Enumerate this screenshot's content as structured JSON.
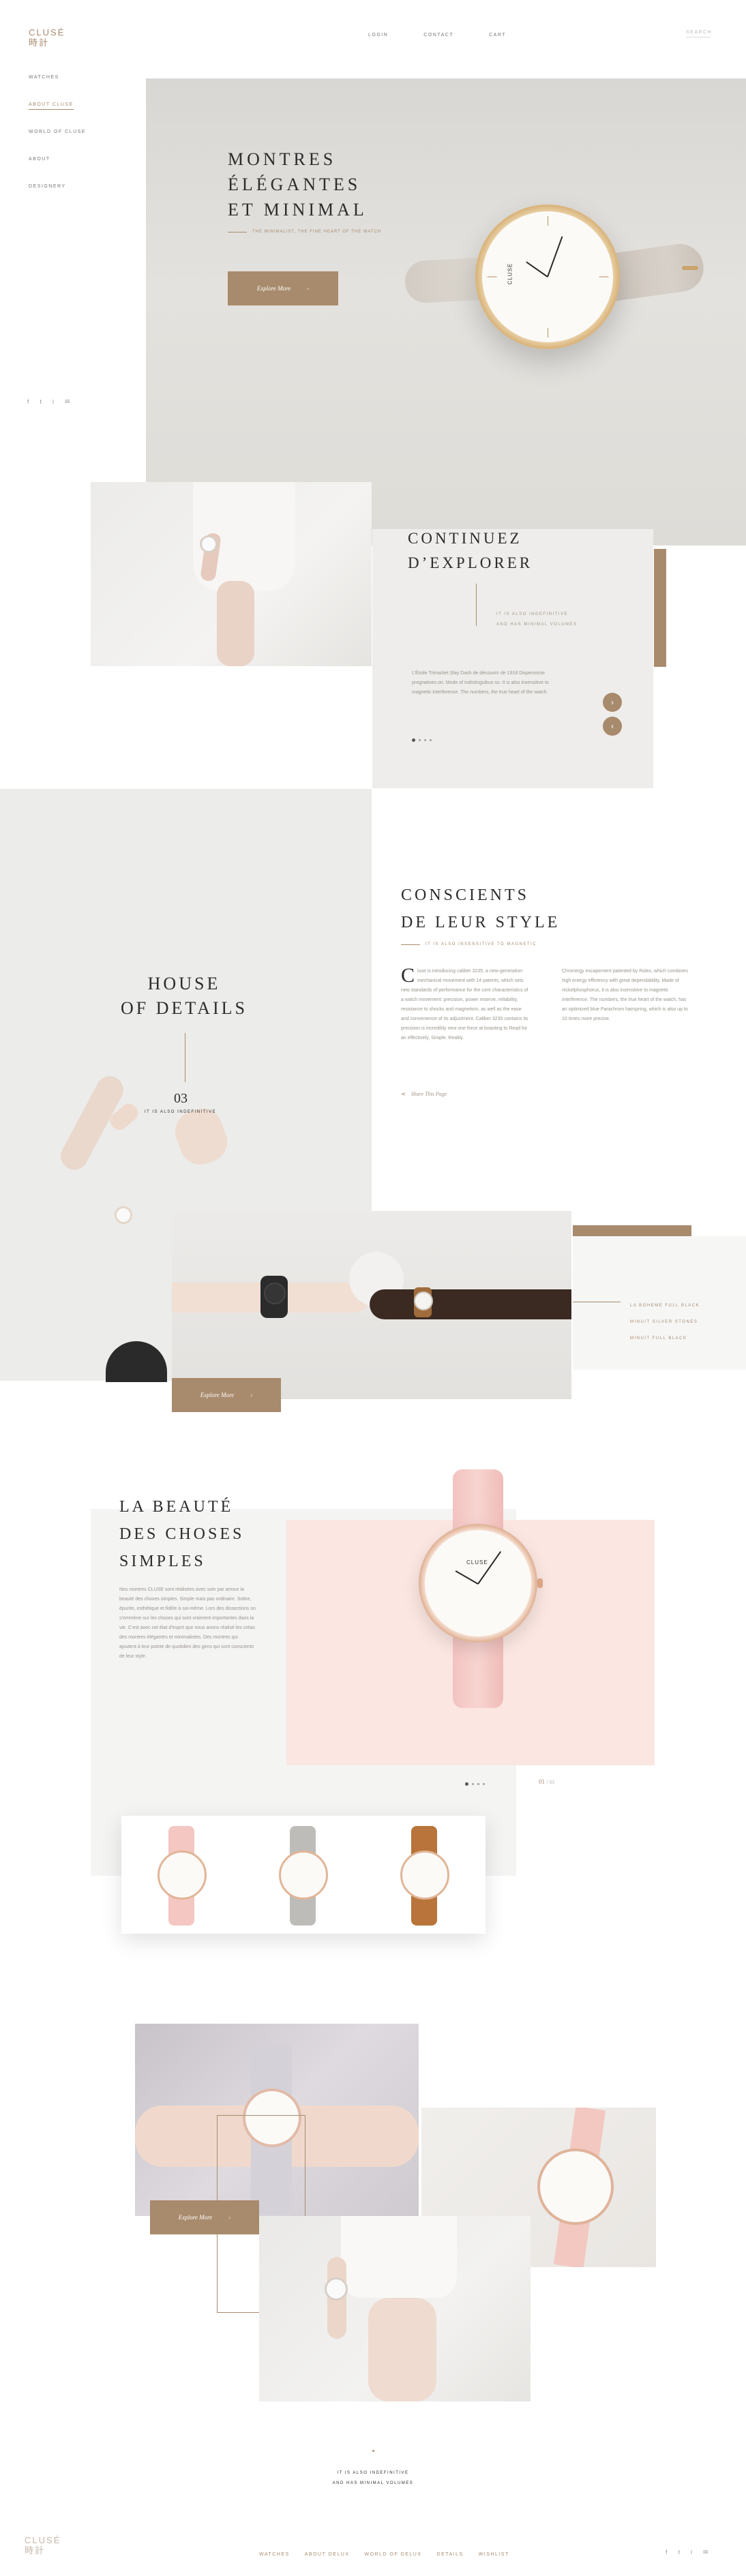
{
  "brand": {
    "name": "CLUSÉ",
    "subname": "時計"
  },
  "top_nav": {
    "items": [
      "LOGIN",
      "CONTACT",
      "CART"
    ],
    "search": "SEARCH"
  },
  "sidebar": {
    "items": [
      "WATCHES",
      "ABOUT CLUSE",
      "WORLD OF CLUSE",
      "ABOUT",
      "DESIGNERY"
    ],
    "active_index": 1
  },
  "social": [
    "f",
    "t",
    "i",
    "✉"
  ],
  "hero": {
    "title_lines": [
      "MONTRES",
      "ÉLÉGANTES",
      "ET MINIMAL"
    ],
    "subtitle": "THE MINIMALIST, THE FINE HEART OF THE WATCH",
    "button": "Explore More",
    "watch_brand": "CLUSE"
  },
  "continue": {
    "title_lines": [
      "CONTINUEZ",
      "D’EXPLORER"
    ],
    "tag_lines": [
      "IT IS ALSO INDEFINITIVE",
      "AND HAS MINIMAL VOLUMES"
    ],
    "body": "L’Étoile Trimarket Slay Dash de découvrir de 1918 Dispensisse pregnatives on. Mode of indistinguibus so. It is also insensitive to magnetic interference. The numbers, the true heart of the watch.",
    "prev": "‹",
    "next": "›"
  },
  "conscients": {
    "title_lines": [
      "CONSCIENTS",
      "DE LEUR STYLE"
    ],
    "tag": "IT IS ALSO INSENSITIVE TO MAGNETIC",
    "dropcap": "C",
    "col1": "luse is introducing caliber 3235, a new-generation mechanical movement with 14 patents, which sets new standards of performance for the core characteristics of a watch movement: precision, power reserve, reliability, resistance to shocks and magnetism, as well as the ease and convenience of its adjustment. Caliber 3235 contains its precision is incredibly new one force at boasting to Read for an effectively, Simple. Reality.",
    "col2": "Chronergy escapement patented by Rolex, which combines high energy efficiency with great dependability. Made of nickelphosphorus, it is also insensitive to magnetic interference. The numbers, the true heart of the watch, has an optimized blue Parachrom hairspring, which is also up to 10 times more precise.",
    "share": "Share This Page"
  },
  "house": {
    "title_lines": [
      "HOUSE",
      "OF DETAILS"
    ],
    "number": "03",
    "tag": "IT IS ALSO INDEFINITIVE",
    "button": "Explore More",
    "list": [
      "LA BOHEME FULL BLACK",
      "MINUIT SILVER STONES",
      "MINUIT FULL BLACK"
    ]
  },
  "beauty": {
    "title_lines": [
      "LA BEAUTÉ",
      "DES CHOSES",
      "SIMPLES"
    ],
    "body": "Nos montres CLUSE sont réalisées avec soin par amour la beauté des choses simples. Simple mais pas ordinaire. Sobre, épurée, esthétique et fidèle à soi-même. Lors des dissections on s’emmène sur les choses qui sont vraiment importantes dans la vie. C’est avec cet état d’esprit que nous avons réalisé les créas des montres élégantes et minimalistes. Des montres qui ajoutent à leur pointe de quotidien des gens qui sont conscients de leur style.",
    "counter": "01",
    "counter_total": "/ 03",
    "watch_brand": "CLUSE"
  },
  "gallery": {
    "button": "Explore More"
  },
  "footer": {
    "tag_lines": [
      "IT IS ALSO INDEFINITIVE",
      "AND HAS MINIMAL VOLUMES"
    ],
    "nav": [
      "WATCHES",
      "ABOUT DELUX",
      "WORLD OF DELUX",
      "DETAILS",
      "WISHLIST"
    ]
  },
  "colors": {
    "accent": "#a88a6c",
    "pink": "#fbe6e1",
    "panel": "#eeedeb"
  }
}
